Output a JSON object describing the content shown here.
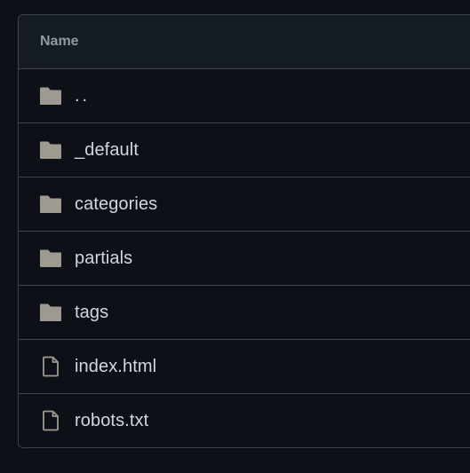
{
  "table": {
    "header": "Name",
    "rows": [
      {
        "name": "..",
        "type": "folder",
        "icon": "folder-icon"
      },
      {
        "name": "_default",
        "type": "folder",
        "icon": "folder-icon"
      },
      {
        "name": "categories",
        "type": "folder",
        "icon": "folder-icon"
      },
      {
        "name": "partials",
        "type": "folder",
        "icon": "folder-icon"
      },
      {
        "name": "tags",
        "type": "folder",
        "icon": "folder-icon"
      },
      {
        "name": "index.html",
        "type": "file",
        "icon": "file-icon"
      },
      {
        "name": "robots.txt",
        "type": "file",
        "icon": "file-icon"
      }
    ]
  },
  "colors": {
    "background": "#0d1117",
    "header_background": "#151b23",
    "border": "#3d444d",
    "text": "#d1d7e0",
    "muted_text": "#9198a1",
    "icon": "#9f9a91"
  }
}
